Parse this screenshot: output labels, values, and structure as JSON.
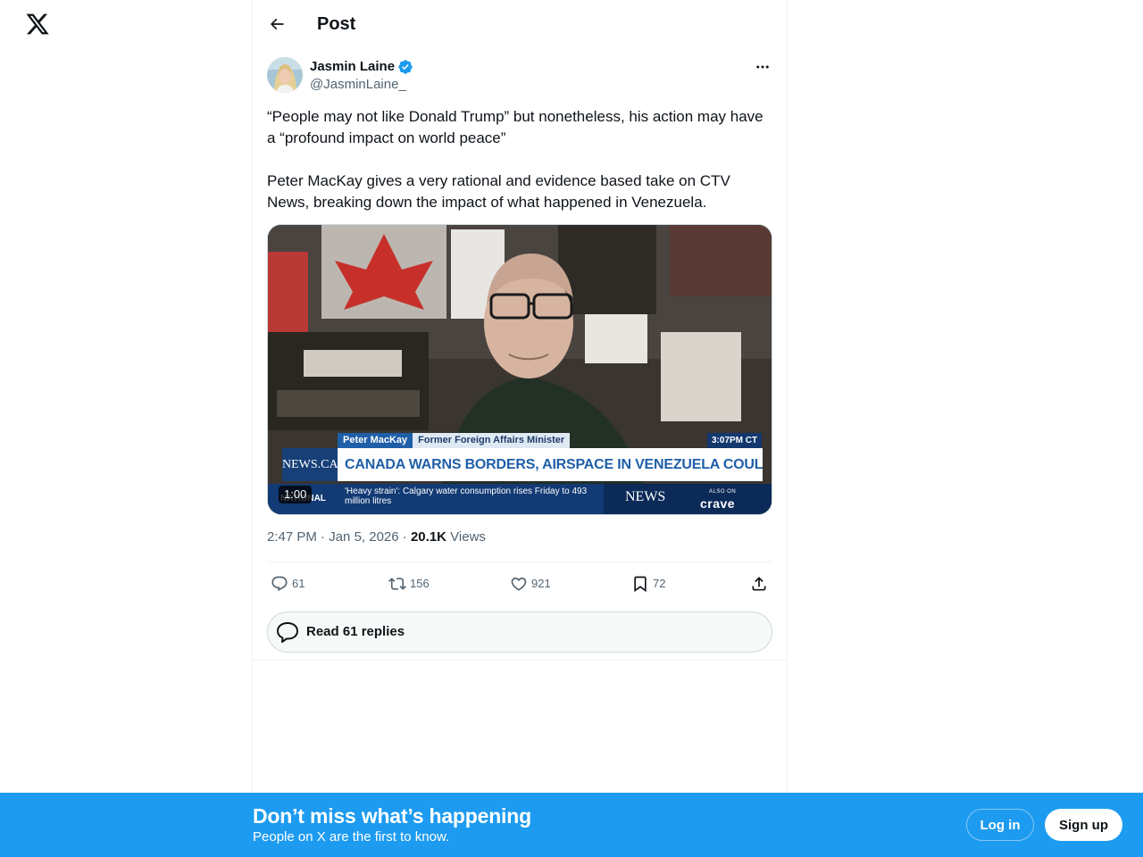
{
  "header": {
    "title": "Post"
  },
  "author": {
    "display_name": "Jasmin Laine",
    "handle": "@JasminLaine_",
    "verified": true
  },
  "tweet": {
    "paragraphs": [
      "“People may not like Donald Trump” but nonetheless, his action may have a “profound impact on world peace”",
      "Peter MacKay gives a very rational and evidence based take on CTV News, breaking down the impact of what happened in Venezuela."
    ],
    "media": {
      "duration": "1:00",
      "tv_name": "Peter MacKay",
      "tv_role": "Former Foreign Affairs Minister",
      "tv_time": "3:07PM CT",
      "tv_headline": "CANADA WARNS BORDERS, AIRSPACE IN VENEZUELA COULD CLOSE",
      "tv_logo": "NEWS.CA",
      "tv_ticker_tag": "NATIONAL",
      "tv_ticker": "'Heavy strain': Calgary water consumption rises Friday to 493 million litres",
      "tv_brand": "NEWS",
      "tv_also_on": "ALSO ON",
      "tv_crave": "crave"
    },
    "meta": {
      "time": "2:47 PM",
      "separator": "·",
      "date": "Jan 5, 2026",
      "views_count": "20.1K",
      "views_label": "Views"
    }
  },
  "actions": {
    "replies": "61",
    "reposts": "156",
    "likes": "921",
    "bookmarks": "72"
  },
  "read_replies": {
    "label": "Read 61 replies"
  },
  "banner": {
    "title": "Don’t miss what’s happening",
    "subtitle": "People on X are the first to know.",
    "login_label": "Log in",
    "signup_label": "Sign up"
  },
  "icons": {
    "logo": "x-logo-icon",
    "back": "arrow-left-icon",
    "verified": "verified-badge-icon",
    "more": "more-dots-icon",
    "reply": "reply-icon",
    "repost": "repost-icon",
    "like": "heart-icon",
    "bookmark": "bookmark-icon",
    "share": "share-icon",
    "replies_bubble": "speech-bubble-icon"
  },
  "colors": {
    "accent": "#1d9bf0",
    "text_primary": "#0f1419",
    "text_secondary": "#536471",
    "border": "#eff3f4"
  }
}
